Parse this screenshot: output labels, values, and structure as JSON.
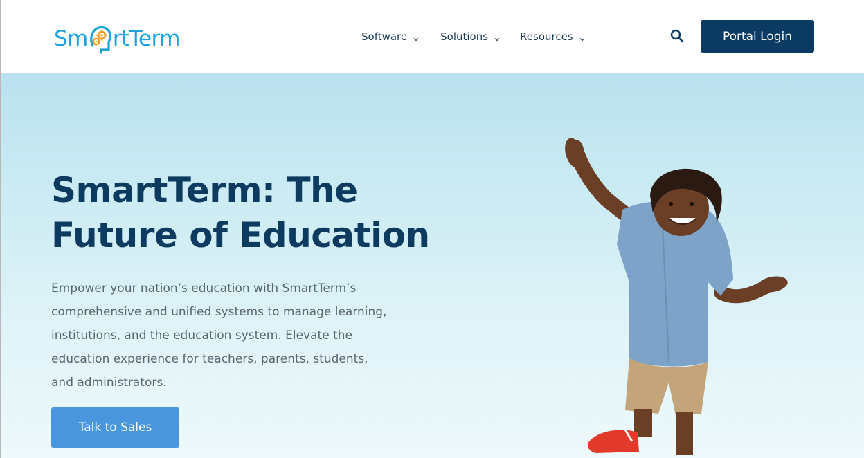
{
  "header": {
    "logo_text_start": "Sm",
    "logo_text_end": "rtTerm",
    "nav": [
      {
        "label": "Software"
      },
      {
        "label": "Solutions"
      },
      {
        "label": "Resources"
      }
    ],
    "portal_login_label": "Portal Login"
  },
  "hero": {
    "title": "SmartTerm: The Future of Education",
    "description": "Empower your nation’s education with SmartTerm’s comprehensive and unified systems to manage learning, institutions, and the education system. Elevate the education experience for teachers, parents, students, and administrators.",
    "cta_label": "Talk to Sales"
  },
  "colors": {
    "brand_blue": "#1aa3dc",
    "navy": "#0b3a63",
    "cta_blue": "#4a96dc",
    "logo_orange": "#f29a1f"
  },
  "icons": {
    "search": "search-icon",
    "chevron": "chevron-down-icon",
    "logo_mark": "head-gear-icon"
  }
}
